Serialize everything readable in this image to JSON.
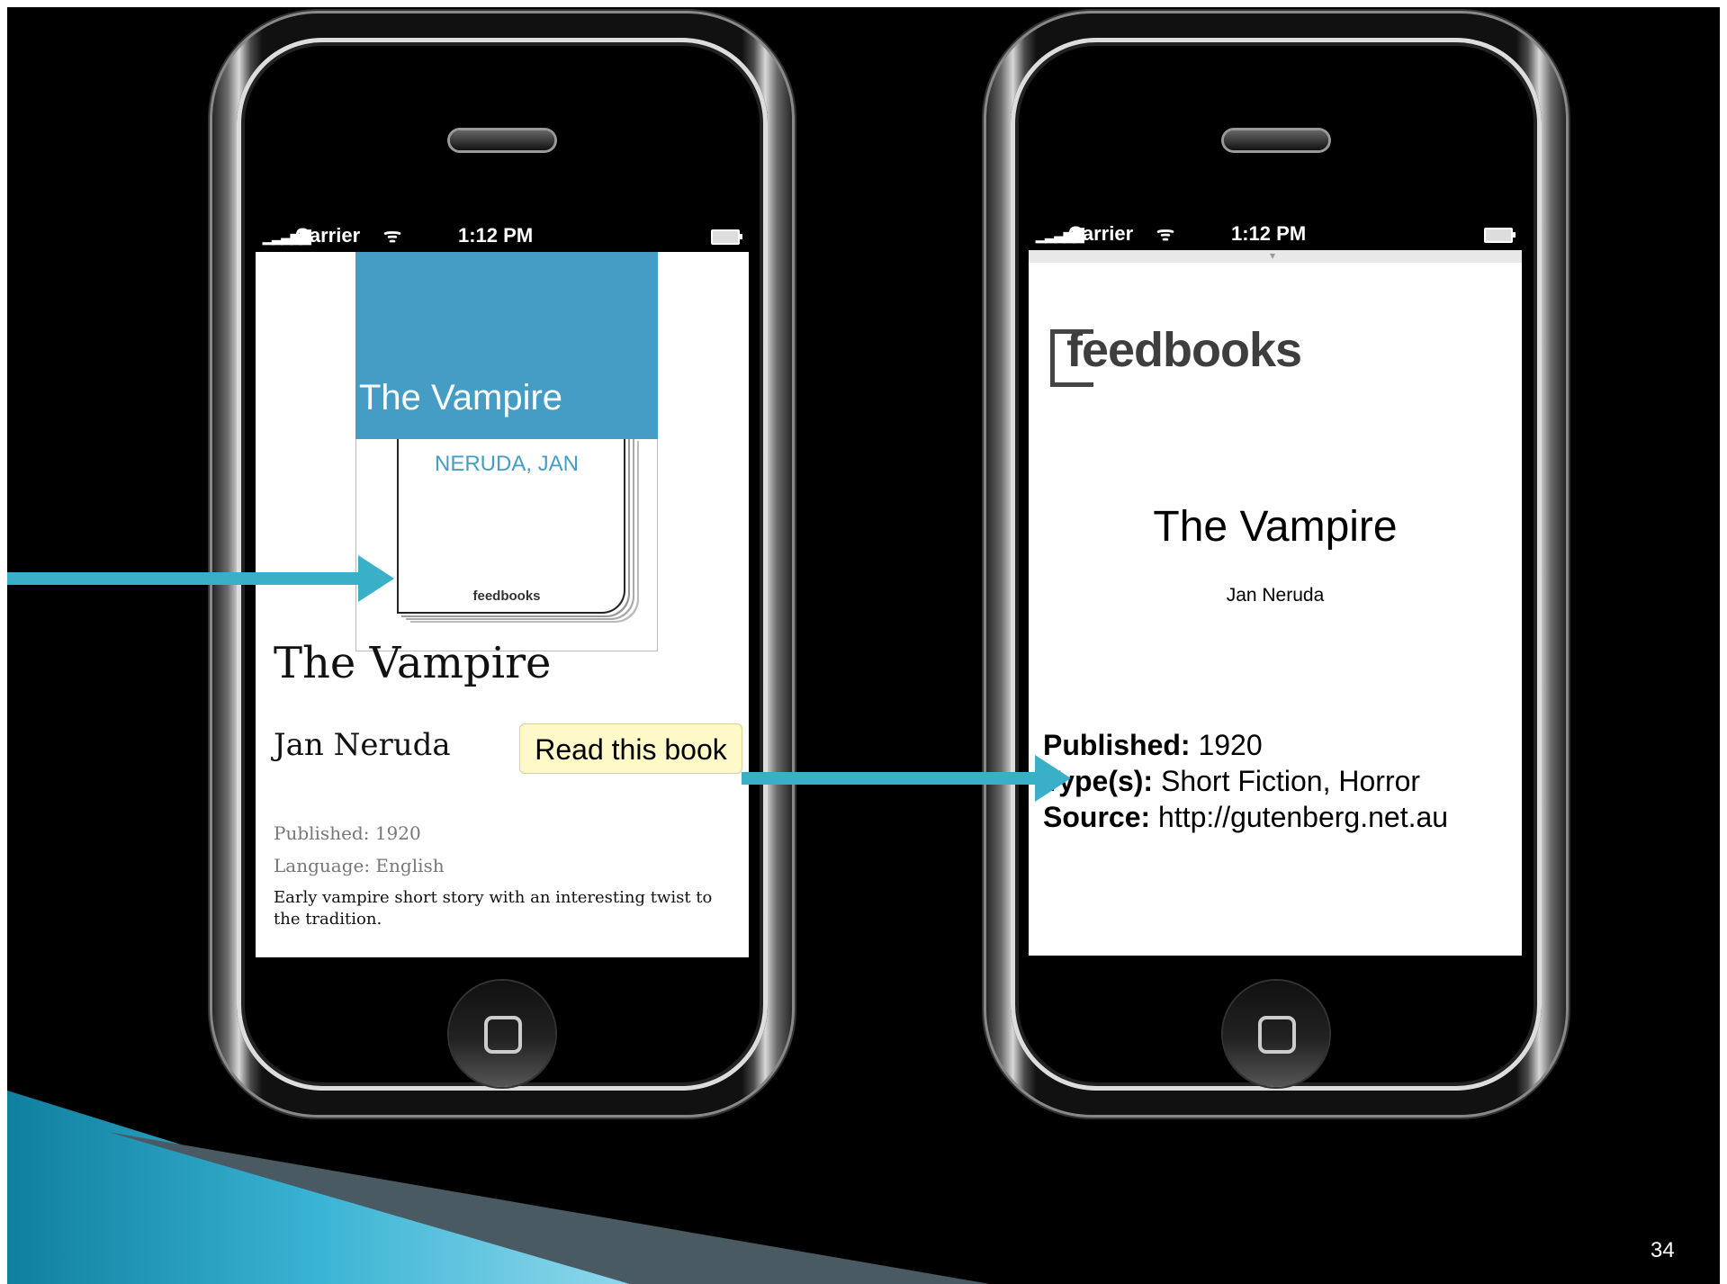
{
  "phone_left": {
    "status": {
      "carrier": "Carrier",
      "time": "1:12 PM"
    },
    "cover": {
      "title": "The Vampire",
      "author": "NERUDA, JAN",
      "logo": "feedbooks"
    },
    "book": {
      "title": "The Vampire",
      "author": "Jan Neruda",
      "read_button": "Read this book",
      "published": "Published: 1920",
      "language": "Language: English",
      "description": "Early vampire short story with an interesting twist to the tradition."
    }
  },
  "phone_right": {
    "status": {
      "carrier": "Carrier",
      "time": "1:12 PM"
    },
    "logo": "feedbooks",
    "title": "The Vampire",
    "author": "Jan Neruda",
    "published": {
      "label": "Published:",
      "value": "1920"
    },
    "types": {
      "label": "Type(s):",
      "value": "Short Fiction, Horror"
    },
    "source": {
      "label": "Source:",
      "value": "http://gutenberg.net.au"
    }
  },
  "slide_number": "34",
  "colors": {
    "accent": "#3ab0c8",
    "cover_band": "#459dc6",
    "button_bg": "#fff8c8"
  }
}
